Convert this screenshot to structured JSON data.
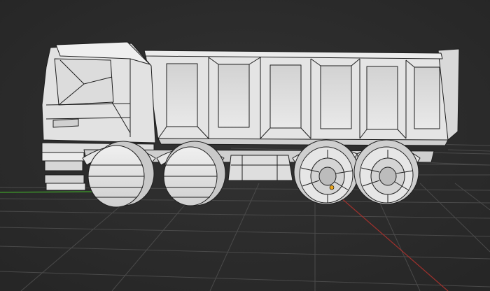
{
  "viewport": {
    "background": "#2b2b2b",
    "grid_color": "#4a4a4a",
    "x_axis_color": "#a0312d",
    "y_axis_color": "#3b8a2a",
    "origin_marker_color": "#e8a21a"
  },
  "model": {
    "subject": "dump-truck",
    "shading": "solid-with-wireframe",
    "body_color": "#e6e6e6",
    "shadow_color": "#bdbdbd",
    "edge_color": "#1e1e1e"
  }
}
